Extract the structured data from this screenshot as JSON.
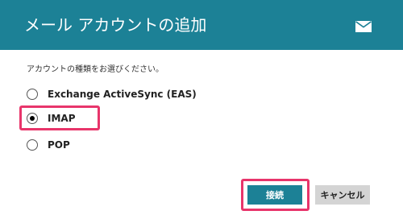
{
  "dialog": {
    "title": "メール アカウントの追加",
    "header_icon": "mail-icon",
    "prompt": "アカウントの種類をお選びください。",
    "account_types": [
      {
        "label": "Exchange ActiveSync (EAS)",
        "selected": false
      },
      {
        "label": "IMAP",
        "selected": true
      },
      {
        "label": "POP",
        "selected": false
      }
    ],
    "buttons": {
      "connect_label": "接続",
      "cancel_label": "キャンセル"
    }
  },
  "colors": {
    "header": "#1c8196",
    "primary_button": "#1c8196",
    "secondary_button": "#d4d4d4",
    "highlight": "#e8356b"
  }
}
